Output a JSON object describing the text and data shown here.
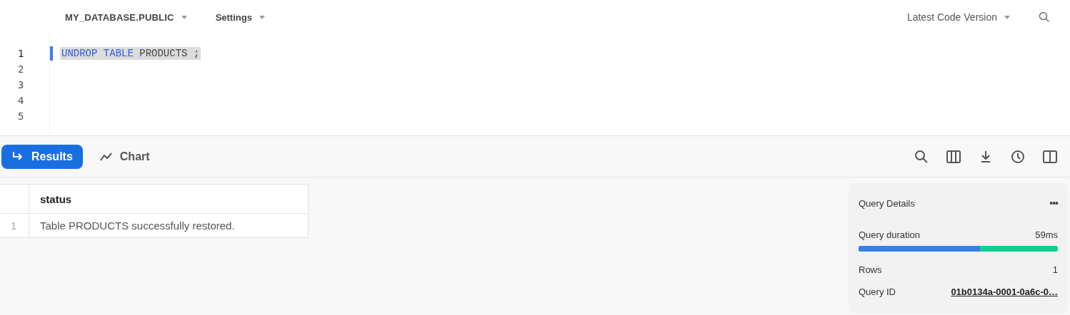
{
  "toolbar": {
    "context": "MY_DATABASE.PUBLIC",
    "settings": "Settings",
    "version": "Latest Code Version"
  },
  "editor": {
    "lines": [
      {
        "number": "1",
        "active": true,
        "tokens": [
          {
            "kind": "keyword",
            "text": "UNDROP"
          },
          {
            "kind": "keyword",
            "text": "TABLE"
          },
          {
            "kind": "identifier",
            "text": "PRODUCTS"
          },
          {
            "kind": "identifier",
            "text": ";"
          }
        ]
      },
      {
        "number": "2",
        "active": false
      },
      {
        "number": "3",
        "active": false
      },
      {
        "number": "4",
        "active": false
      },
      {
        "number": "5",
        "active": false
      }
    ]
  },
  "tabs": [
    {
      "label": "Results",
      "selected": true,
      "kind": "results"
    },
    {
      "label": "Chart",
      "selected": false,
      "kind": "chart"
    }
  ],
  "table": {
    "columns": [
      "status"
    ],
    "rows": [
      {
        "index": "1",
        "cells": [
          "Table PRODUCTS successfully restored."
        ]
      }
    ]
  },
  "query_details": {
    "title": "Query Details",
    "menu": "•••",
    "duration_label": "Query duration",
    "duration": "59ms",
    "level": 0.61,
    "rows_label": "Rows",
    "rows": "1",
    "id_label": "Query ID",
    "id": "01b0134a-0001-0a6c-0…"
  }
}
